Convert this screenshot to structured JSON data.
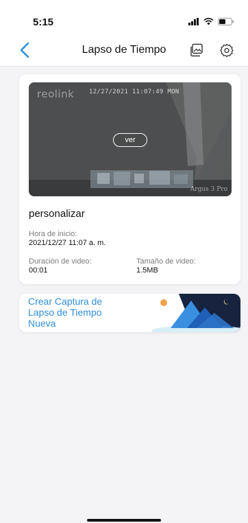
{
  "status_bar": {
    "time": "5:15"
  },
  "nav": {
    "title": "Lapso de Tiempo",
    "back_icon": "chevron-left-icon",
    "gallery_icon": "gallery-icon",
    "settings_icon": "gear-icon"
  },
  "card": {
    "thumbnail": {
      "brand": "reolink",
      "timestamp": "12/27/2021 11:07:49 MON",
      "model": "Argus 3 Pro"
    },
    "view_button_label": "ver",
    "title": "personalizar",
    "start_label": "Hora de inicio:",
    "start_value": "2021/12/27 11:07 a. m.",
    "duration_label": "Duración de video:",
    "duration_value": "00:01",
    "size_label": "Tamaño de video:",
    "size_value": "1.5MB"
  },
  "banner": {
    "text": "Crear Captura de Lapso de Tiempo Nueva",
    "accent_color": "#2f8fd8"
  }
}
